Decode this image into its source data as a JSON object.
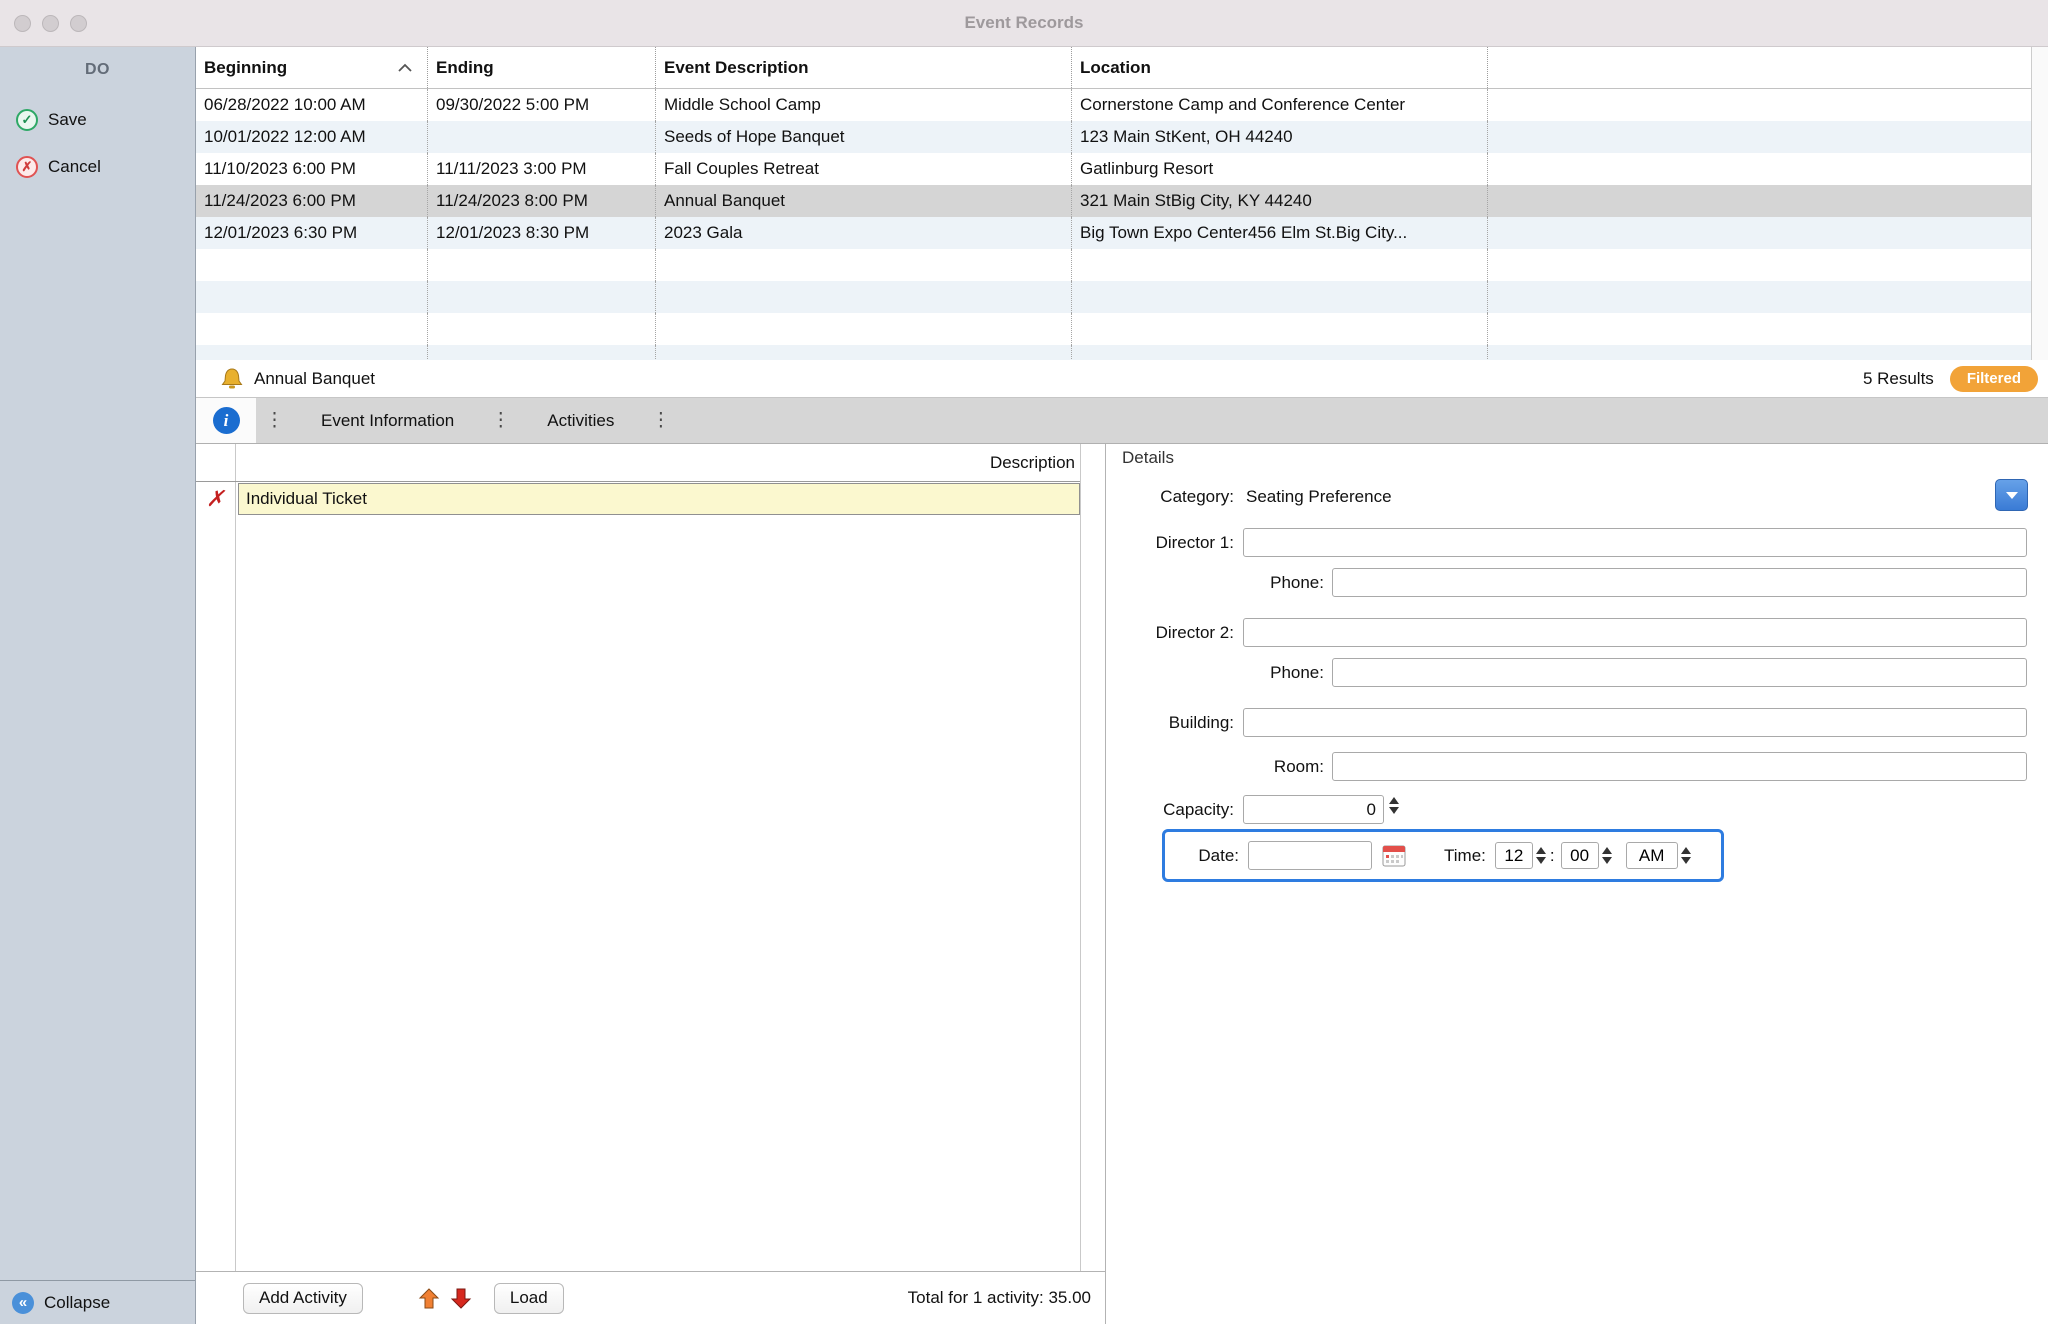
{
  "colors": {
    "accent_blue": "#2e7ce0",
    "filtered_orange": "#f2a338",
    "selected_row_gray": "#d5d5d5",
    "activity_highlight_yellow": "#fbf8cf",
    "sidebar_gray_blue": "#cbd3dd"
  },
  "window": {
    "title": "Event Records"
  },
  "sidebar": {
    "header": "DO",
    "save": "Save",
    "cancel": "Cancel",
    "collapse": "Collapse"
  },
  "records_table": {
    "headers": {
      "beginning": "Beginning",
      "ending": "Ending",
      "description": "Event Description",
      "location": "Location"
    },
    "rows": [
      {
        "beginning": "06/28/2022 10:00 AM",
        "ending": "09/30/2022 5:00 PM",
        "description": "Middle School Camp",
        "location": "Cornerstone Camp and Conference Center",
        "selected": false
      },
      {
        "beginning": "10/01/2022 12:00 AM",
        "ending": "",
        "description": "Seeds of Hope Banquet",
        "location": "123 Main StKent, OH 44240",
        "selected": false
      },
      {
        "beginning": "11/10/2023 6:00 PM",
        "ending": "11/11/2023 3:00 PM",
        "description": "Fall Couples Retreat",
        "location": "Gatlinburg Resort",
        "selected": false
      },
      {
        "beginning": "11/24/2023 6:00 PM",
        "ending": "11/24/2023 8:00 PM",
        "description": "Annual Banquet",
        "location": "321 Main StBig City, KY 44240",
        "selected": true
      },
      {
        "beginning": "12/01/2023 6:30 PM",
        "ending": "12/01/2023 8:30 PM",
        "description": "2023 Gala",
        "location": "Big Town Expo Center456 Elm St.Big City...",
        "selected": false
      }
    ]
  },
  "section_header": {
    "icon": "bell-icon",
    "title": "Annual Banquet",
    "results": "5 Results",
    "badge": "Filtered"
  },
  "tab_bar": {
    "info_icon": "info-icon",
    "tabs": [
      "Event Information",
      "Activities"
    ]
  },
  "activities": {
    "header": "Description",
    "rows": [
      {
        "description": "Individual Ticket"
      }
    ],
    "add_button": "Add Activity",
    "load_button": "Load",
    "total": "Total for 1 activity: 35.00"
  },
  "details": {
    "title": "Details",
    "category": {
      "label": "Category:",
      "value": "Seating Preference"
    },
    "director1": {
      "label": "Director 1:",
      "value": ""
    },
    "phone1": {
      "label": "Phone:",
      "value": ""
    },
    "director2": {
      "label": "Director 2:",
      "value": ""
    },
    "phone2": {
      "label": "Phone:",
      "value": ""
    },
    "building": {
      "label": "Building:",
      "value": ""
    },
    "room": {
      "label": "Room:",
      "value": ""
    },
    "capacity": {
      "label": "Capacity:",
      "value": "0"
    },
    "date": {
      "label": "Date:",
      "value": ""
    },
    "time": {
      "label": "Time:",
      "hour": "12",
      "separator": ":",
      "minute": "00",
      "ampm": "AM"
    }
  }
}
